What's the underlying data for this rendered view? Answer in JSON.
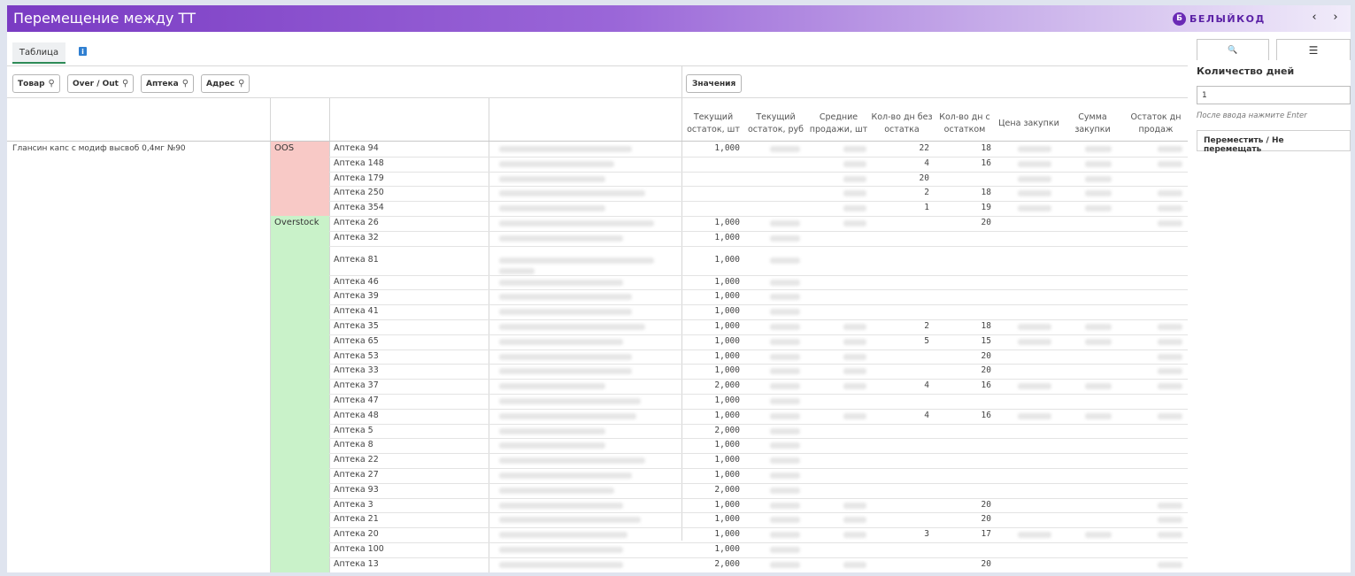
{
  "header": {
    "title": "Перемещение между ТТ",
    "brand_mark": "Б",
    "brand_text": "БЕЛЫЙКОД",
    "prev_label": "‹",
    "next_label": "›"
  },
  "tabs": {
    "table_label": "Таблица",
    "info_label": "i"
  },
  "filters": {
    "product": "Товар",
    "over_out": "Over / Out",
    "pharmacy": "Аптека",
    "address": "Адрес",
    "values": "Значения"
  },
  "columns": [
    "Текущий остаток, шт",
    "Текущий остаток, руб",
    "Средние продажи, шт",
    "Кол-во дн без остатка",
    "Кол-во дн с остатком",
    "Цена закупки",
    "Сумма закупки",
    "Остаток дн продаж"
  ],
  "product": "Глансин капс с модиф высвоб 0,4мг №90",
  "statuses": {
    "oos": "OOS",
    "overstock": "Overstock"
  },
  "colors": {
    "oos_bg": "#f8c9c6",
    "overstock_bg": "#c9f2c9",
    "accent": "#7a3bc3"
  },
  "rows": [
    {
      "pharmacy": "Аптека 94",
      "stock": "1,000",
      "no_stock": "22",
      "with_stock": "18"
    },
    {
      "pharmacy": "Аптека 148",
      "stock": "",
      "no_stock": "4",
      "with_stock": "16"
    },
    {
      "pharmacy": "Аптека 179",
      "stock": "",
      "no_stock": "20",
      "with_stock": ""
    },
    {
      "pharmacy": "Аптека 250",
      "stock": "",
      "no_stock": "2",
      "with_stock": "18"
    },
    {
      "pharmacy": "Аптека 354",
      "stock": "",
      "no_stock": "1",
      "with_stock": "19"
    },
    {
      "pharmacy": "Аптека 26",
      "stock": "1,000",
      "no_stock": "",
      "with_stock": "20"
    },
    {
      "pharmacy": "Аптека 32",
      "stock": "1,000",
      "no_stock": "",
      "with_stock": ""
    },
    {
      "pharmacy": "Аптека 81",
      "stock": "1,000",
      "no_stock": "",
      "with_stock": ""
    },
    {
      "pharmacy": "Аптека 46",
      "stock": "1,000",
      "no_stock": "",
      "with_stock": ""
    },
    {
      "pharmacy": "Аптека 39",
      "stock": "1,000",
      "no_stock": "",
      "with_stock": ""
    },
    {
      "pharmacy": "Аптека 41",
      "stock": "1,000",
      "no_stock": "",
      "with_stock": ""
    },
    {
      "pharmacy": "Аптека 35",
      "stock": "1,000",
      "no_stock": "2",
      "with_stock": "18"
    },
    {
      "pharmacy": "Аптека 65",
      "stock": "1,000",
      "no_stock": "5",
      "with_stock": "15"
    },
    {
      "pharmacy": "Аптека 53",
      "stock": "1,000",
      "no_stock": "",
      "with_stock": "20"
    },
    {
      "pharmacy": "Аптека 33",
      "stock": "1,000",
      "no_stock": "",
      "with_stock": "20"
    },
    {
      "pharmacy": "Аптека 37",
      "stock": "2,000",
      "no_stock": "4",
      "with_stock": "16"
    },
    {
      "pharmacy": "Аптека 47",
      "stock": "1,000",
      "no_stock": "",
      "with_stock": ""
    },
    {
      "pharmacy": "Аптека 48",
      "stock": "1,000",
      "no_stock": "4",
      "with_stock": "16"
    },
    {
      "pharmacy": "Аптека 5",
      "stock": "2,000",
      "no_stock": "",
      "with_stock": ""
    },
    {
      "pharmacy": "Аптека 8",
      "stock": "1,000",
      "no_stock": "",
      "with_stock": ""
    },
    {
      "pharmacy": "Аптека 22",
      "stock": "1,000",
      "no_stock": "",
      "with_stock": ""
    },
    {
      "pharmacy": "Аптека 27",
      "stock": "1,000",
      "no_stock": "",
      "with_stock": ""
    },
    {
      "pharmacy": "Аптека 93",
      "stock": "2,000",
      "no_stock": "",
      "with_stock": ""
    },
    {
      "pharmacy": "Аптека 3",
      "stock": "1,000",
      "no_stock": "",
      "with_stock": "20"
    },
    {
      "pharmacy": "Аптека 21",
      "stock": "1,000",
      "no_stock": "",
      "with_stock": "20"
    },
    {
      "pharmacy": "Аптека 20",
      "stock": "1,000",
      "no_stock": "3",
      "with_stock": "17"
    },
    {
      "pharmacy": "Аптека 100",
      "stock": "1,000",
      "no_stock": "",
      "with_stock": ""
    },
    {
      "pharmacy": "Аптека 13",
      "stock": "2,000",
      "no_stock": "",
      "with_stock": "20"
    }
  ],
  "side": {
    "search_icon": "🔍",
    "menu_icon": "☰",
    "days_label": "Количество дней",
    "days_value": "1",
    "hint": "После ввода нажмите Enter",
    "move_label": "Переместить / Не перемещать"
  }
}
